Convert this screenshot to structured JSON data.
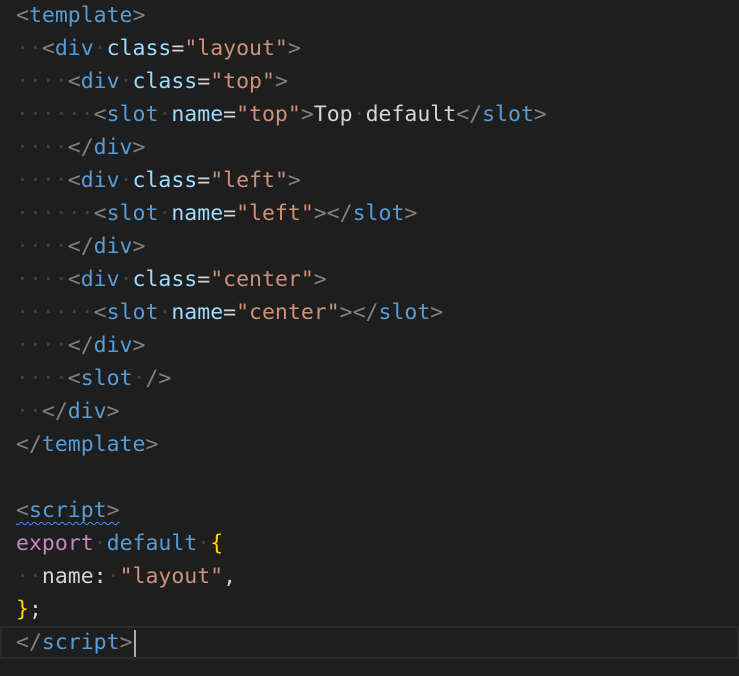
{
  "editor": {
    "theme_colors": {
      "background": "#1e1e1e",
      "tag": "#569cd6",
      "attribute": "#9cdcfe",
      "string": "#ce9178",
      "bracket": "#808080",
      "keyword": "#c586c0",
      "brace": "#ffd700"
    },
    "lines": [
      [
        {
          "t": "bracket",
          "v": "<"
        },
        {
          "t": "tag",
          "v": "template"
        },
        {
          "t": "bracket",
          "v": ">"
        }
      ],
      [
        {
          "t": "ws",
          "v": "··"
        },
        {
          "t": "bracket",
          "v": "<"
        },
        {
          "t": "tag",
          "v": "div"
        },
        {
          "t": "ws",
          "v": "·"
        },
        {
          "t": "attr",
          "v": "class"
        },
        {
          "t": "punct",
          "v": "="
        },
        {
          "t": "str",
          "v": "\"layout\""
        },
        {
          "t": "bracket",
          "v": ">"
        }
      ],
      [
        {
          "t": "ws",
          "v": "····"
        },
        {
          "t": "bracket",
          "v": "<"
        },
        {
          "t": "tag",
          "v": "div"
        },
        {
          "t": "ws",
          "v": "·"
        },
        {
          "t": "attr",
          "v": "class"
        },
        {
          "t": "punct",
          "v": "="
        },
        {
          "t": "str",
          "v": "\"top\""
        },
        {
          "t": "bracket",
          "v": ">"
        }
      ],
      [
        {
          "t": "ws",
          "v": "······"
        },
        {
          "t": "bracket",
          "v": "<"
        },
        {
          "t": "tag",
          "v": "slot"
        },
        {
          "t": "ws",
          "v": "·"
        },
        {
          "t": "attr",
          "v": "name"
        },
        {
          "t": "punct",
          "v": "="
        },
        {
          "t": "str",
          "v": "\"top\""
        },
        {
          "t": "bracket",
          "v": ">"
        },
        {
          "t": "text",
          "v": "Top"
        },
        {
          "t": "ws",
          "v": "·"
        },
        {
          "t": "text",
          "v": "default"
        },
        {
          "t": "bracket",
          "v": "</"
        },
        {
          "t": "tag",
          "v": "slot"
        },
        {
          "t": "bracket",
          "v": ">"
        }
      ],
      [
        {
          "t": "ws",
          "v": "····"
        },
        {
          "t": "bracket",
          "v": "</"
        },
        {
          "t": "tag",
          "v": "div"
        },
        {
          "t": "bracket",
          "v": ">"
        }
      ],
      [
        {
          "t": "ws",
          "v": "····"
        },
        {
          "t": "bracket",
          "v": "<"
        },
        {
          "t": "tag",
          "v": "div"
        },
        {
          "t": "ws",
          "v": "·"
        },
        {
          "t": "attr",
          "v": "class"
        },
        {
          "t": "punct",
          "v": "="
        },
        {
          "t": "str",
          "v": "\"left\""
        },
        {
          "t": "bracket",
          "v": ">"
        }
      ],
      [
        {
          "t": "ws",
          "v": "······"
        },
        {
          "t": "bracket",
          "v": "<"
        },
        {
          "t": "tag",
          "v": "slot"
        },
        {
          "t": "ws",
          "v": "·"
        },
        {
          "t": "attr",
          "v": "name"
        },
        {
          "t": "punct",
          "v": "="
        },
        {
          "t": "str",
          "v": "\"left\""
        },
        {
          "t": "bracket",
          "v": "></"
        },
        {
          "t": "tag",
          "v": "slot"
        },
        {
          "t": "bracket",
          "v": ">"
        }
      ],
      [
        {
          "t": "ws",
          "v": "····"
        },
        {
          "t": "bracket",
          "v": "</"
        },
        {
          "t": "tag",
          "v": "div"
        },
        {
          "t": "bracket",
          "v": ">"
        }
      ],
      [
        {
          "t": "ws",
          "v": "····"
        },
        {
          "t": "bracket",
          "v": "<"
        },
        {
          "t": "tag",
          "v": "div"
        },
        {
          "t": "ws",
          "v": "·"
        },
        {
          "t": "attr",
          "v": "class"
        },
        {
          "t": "punct",
          "v": "="
        },
        {
          "t": "str",
          "v": "\"center\""
        },
        {
          "t": "bracket",
          "v": ">"
        }
      ],
      [
        {
          "t": "ws",
          "v": "······"
        },
        {
          "t": "bracket",
          "v": "<"
        },
        {
          "t": "tag",
          "v": "slot"
        },
        {
          "t": "ws",
          "v": "·"
        },
        {
          "t": "attr",
          "v": "name"
        },
        {
          "t": "punct",
          "v": "="
        },
        {
          "t": "str",
          "v": "\"center\""
        },
        {
          "t": "bracket",
          "v": "></"
        },
        {
          "t": "tag",
          "v": "slot"
        },
        {
          "t": "bracket",
          "v": ">"
        }
      ],
      [
        {
          "t": "ws",
          "v": "····"
        },
        {
          "t": "bracket",
          "v": "</"
        },
        {
          "t": "tag",
          "v": "div"
        },
        {
          "t": "bracket",
          "v": ">"
        }
      ],
      [
        {
          "t": "ws",
          "v": "····"
        },
        {
          "t": "bracket",
          "v": "<"
        },
        {
          "t": "tag",
          "v": "slot"
        },
        {
          "t": "ws",
          "v": "·"
        },
        {
          "t": "bracket",
          "v": "/>"
        }
      ],
      [
        {
          "t": "ws",
          "v": "··"
        },
        {
          "t": "bracket",
          "v": "</"
        },
        {
          "t": "tag",
          "v": "div"
        },
        {
          "t": "bracket",
          "v": ">"
        }
      ],
      [
        {
          "t": "bracket",
          "v": "</"
        },
        {
          "t": "tag",
          "v": "template"
        },
        {
          "t": "bracket",
          "v": ">"
        }
      ],
      [],
      [
        {
          "t": "bracket",
          "v": "<",
          "sq": true
        },
        {
          "t": "tag",
          "v": "script",
          "sq": true
        },
        {
          "t": "bracket",
          "v": ">",
          "sq": true
        }
      ],
      [
        {
          "t": "kw",
          "v": "export"
        },
        {
          "t": "ws",
          "v": "·"
        },
        {
          "t": "kw2",
          "v": "default"
        },
        {
          "t": "ws",
          "v": "·"
        },
        {
          "t": "brace",
          "v": "{"
        }
      ],
      [
        {
          "t": "ws",
          "v": "··"
        },
        {
          "t": "prop",
          "v": "name"
        },
        {
          "t": "punct",
          "v": ":"
        },
        {
          "t": "ws",
          "v": "·"
        },
        {
          "t": "str",
          "v": "\"layout\""
        },
        {
          "t": "punct",
          "v": ","
        }
      ],
      [
        {
          "t": "brace",
          "v": "}"
        },
        {
          "t": "punct",
          "v": ";"
        }
      ],
      [
        {
          "t": "bracket",
          "v": "</"
        },
        {
          "t": "tag",
          "v": "script"
        },
        {
          "t": "bracket",
          "v": ">"
        }
      ]
    ],
    "current_line": 19
  }
}
